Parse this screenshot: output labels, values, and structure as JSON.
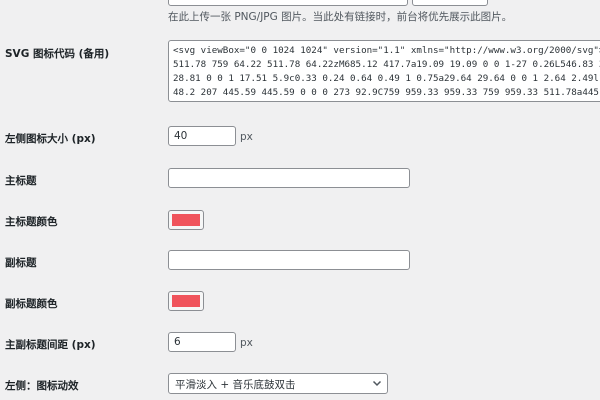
{
  "upload_help": "在此上传一张 PNG/JPG 图片。当此处有链接时，前台将优先展示此图片。",
  "svg_code": {
    "label": "SVG 图标代码 (备用)",
    "lines": [
      "<svg viewBox=\"0 0 1024 1024\" version=\"1.1\" xmlns=\"http://www.w3.org/2000/svg\"><pa",
      "511.78 759 64.22 511.78 64.22zM685.12 417.7a19.09 19.09 0 0 1-27 0.26L546.83 308",
      "28.81 0 0 1 17.51 5.9c0.33 0.24 0.64 0.49 1 0.75a29.64 29.64 0 0 1 2.64 2.49l145",
      "48.2 207 445.59 445.59 0 0 0 273 92.9C759 959.33 959.33 759 959.33 511.78a445.62"
    ]
  },
  "icon_size": {
    "label": "左侧图标大小 (px)",
    "value": "40",
    "unit": "px"
  },
  "main_title": {
    "label": "主标题",
    "value": ""
  },
  "main_title_color": {
    "label": "主标题颜色",
    "color": "#f0545c"
  },
  "subtitle": {
    "label": "副标题",
    "value": ""
  },
  "subtitle_color": {
    "label": "副标题颜色",
    "color": "#f0545c"
  },
  "title_spacing": {
    "label": "主副标题间距 (px)",
    "value": "6",
    "unit": "px"
  },
  "icon_animation": {
    "label": "左侧：图标动效",
    "selected": "平滑淡入 + 音乐底鼓双击"
  }
}
